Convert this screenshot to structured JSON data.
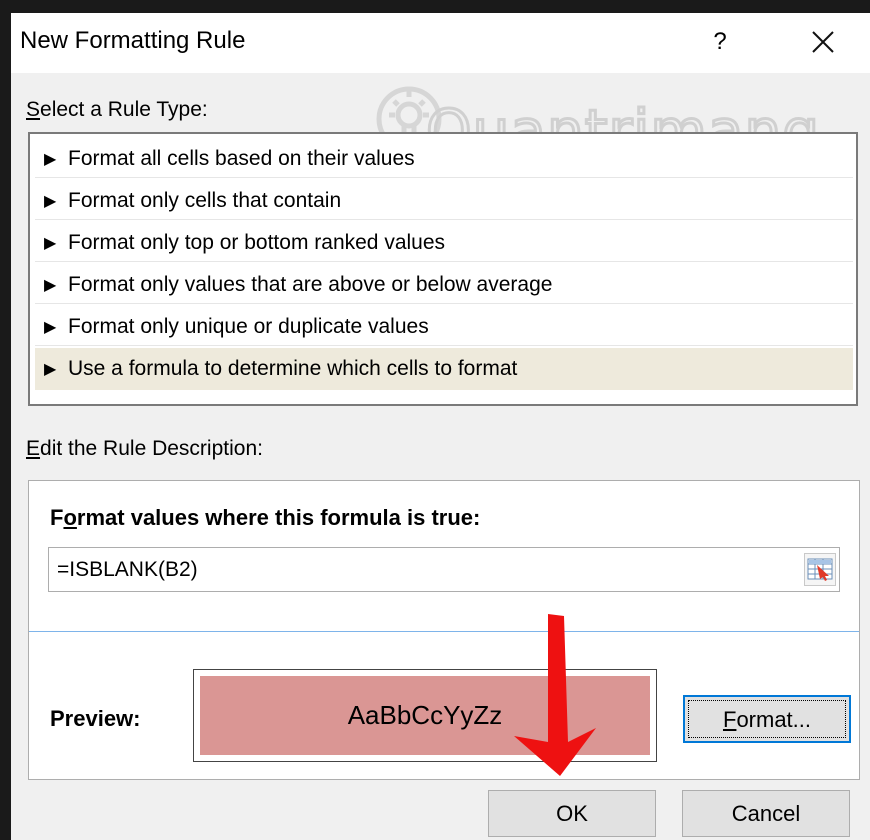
{
  "window": {
    "title": "New Formatting Rule",
    "help_glyph": "?"
  },
  "watermark": {
    "text": "Quantrimang"
  },
  "select_rule": {
    "label_accel": "S",
    "label_rest": "elect a Rule Type:",
    "items": [
      {
        "label": "Format all cells based on their values",
        "selected": false
      },
      {
        "label": "Format only cells that contain",
        "selected": false
      },
      {
        "label": "Format only top or bottom ranked values",
        "selected": false
      },
      {
        "label": "Format only values that are above or below average",
        "selected": false
      },
      {
        "label": "Format only unique or duplicate values",
        "selected": false
      },
      {
        "label": "Use a formula to determine which cells to format",
        "selected": true
      }
    ],
    "bullet": "▶"
  },
  "edit_rule": {
    "label_accel": "E",
    "label_rest": "dit the Rule Description:",
    "formula_label_pre": "F",
    "formula_label_accel": "o",
    "formula_label_rest": "rmat values where this formula is true:",
    "formula_value": "=ISBLANK(B2)",
    "range_icon": "range-selector-icon",
    "preview_label": "Preview:",
    "preview_sample": "AaBbCcYyZz",
    "preview_fill": "#da9694",
    "format_button_accel": "F",
    "format_button_rest": "ormat..."
  },
  "footer": {
    "ok_label": "OK",
    "cancel_label": "Cancel"
  },
  "annotation": {
    "arrow_color": "#ee1111"
  },
  "colors": {
    "focus_border": "#0078d7",
    "selected_row": "#eeeadc",
    "separator": "#7eb4ea"
  }
}
